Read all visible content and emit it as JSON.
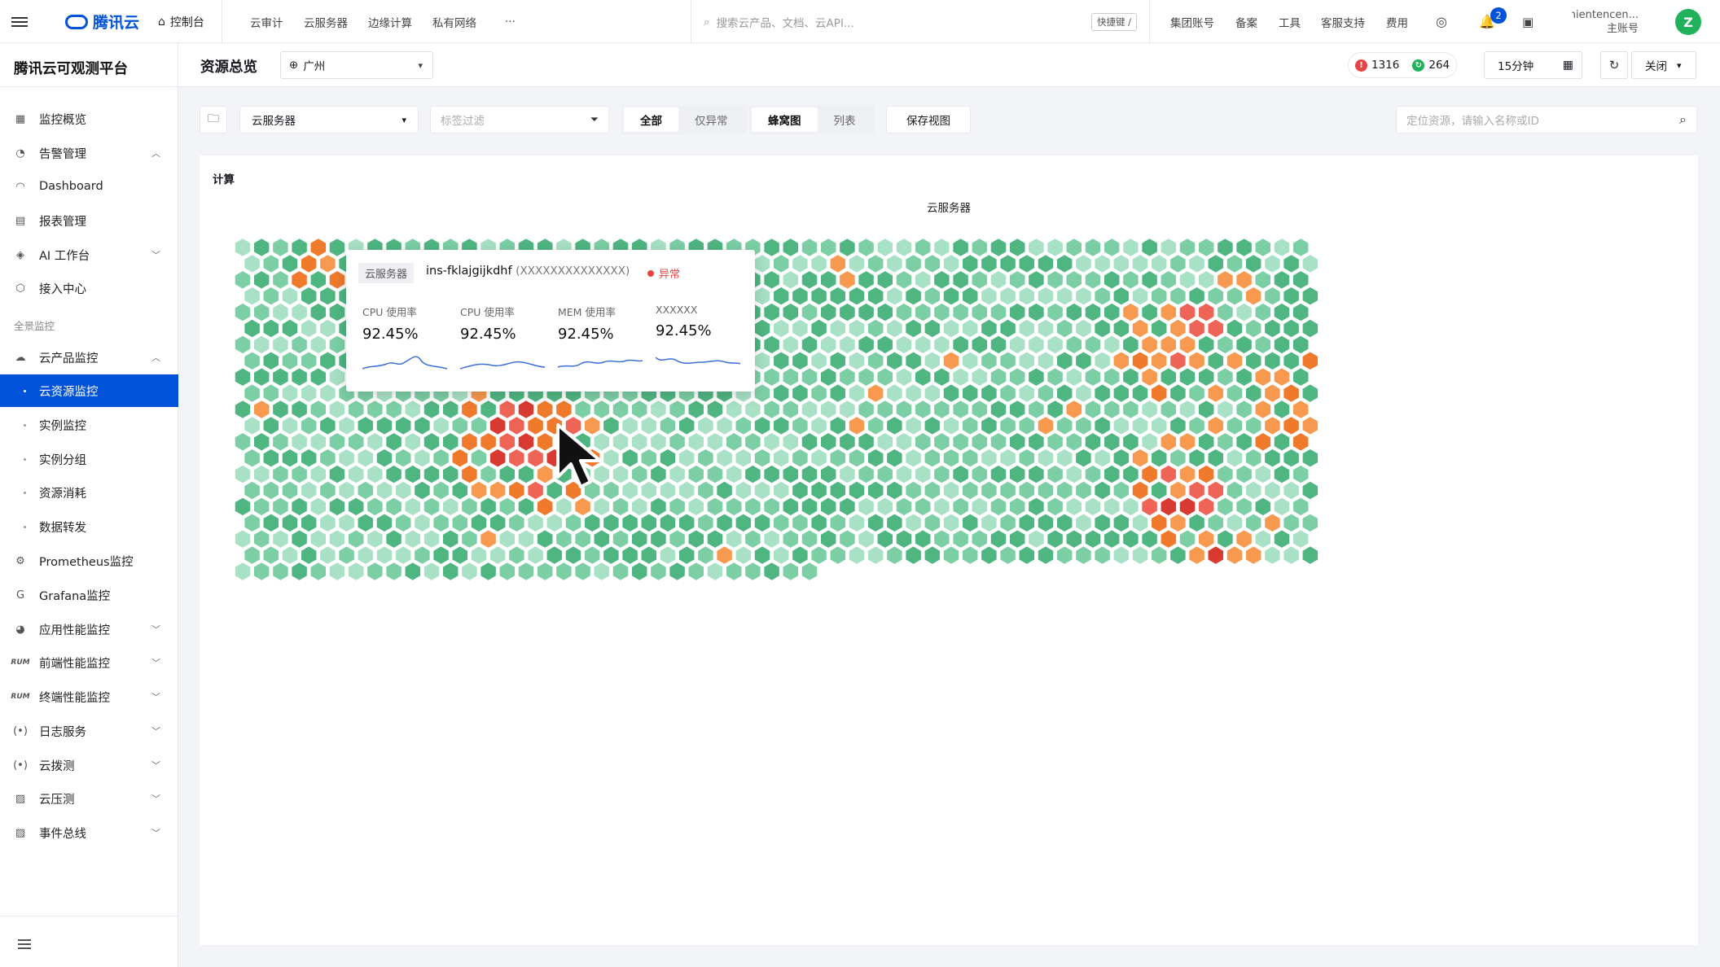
{
  "topbar": {
    "brand": "腾讯云",
    "console": "控制台",
    "nav": [
      "云审计",
      "云服务器",
      "边缘计算",
      "私有网络"
    ],
    "more": "···",
    "search_placeholder": "搜索云产品、文档、云API...",
    "shortcut": "快捷键 /",
    "links": [
      "集团账号",
      "备案",
      "工具",
      "客服支持",
      "费用"
    ],
    "notification_count": "2",
    "account_name": "milachientencen...",
    "account_role": "主账号",
    "avatar_letter": "Z"
  },
  "sidebar": {
    "title": "腾讯云可观测平台",
    "items": [
      {
        "label": "监控概览",
        "icon": "grid-icon"
      },
      {
        "label": "告警管理",
        "icon": "alarm-icon",
        "chevron": "up"
      },
      {
        "label": "Dashboard",
        "icon": "gauge-icon"
      },
      {
        "label": "报表管理",
        "icon": "report-icon"
      },
      {
        "label": "AI 工作台",
        "icon": "ai-icon",
        "chevron": "down"
      },
      {
        "label": "接入中心",
        "icon": "hub-icon"
      }
    ],
    "group_label": "全景监控",
    "items2": [
      {
        "label": "云产品监控",
        "icon": "cloud-icon",
        "chevron": "up"
      },
      {
        "label": "云资源监控",
        "sub": true,
        "active": true
      },
      {
        "label": "实例监控",
        "sub": true
      },
      {
        "label": "实例分组",
        "sub": true
      },
      {
        "label": "资源消耗",
        "sub": true
      },
      {
        "label": "数据转发",
        "sub": true
      },
      {
        "label": "Prometheus监控",
        "icon": "prometheus-icon"
      },
      {
        "label": "Grafana监控",
        "icon": "grafana-icon"
      },
      {
        "label": "应用性能监控",
        "icon": "apm-icon",
        "chevron": "down"
      },
      {
        "label": "前端性能监控",
        "icon": "rum-icon",
        "chevron": "down"
      },
      {
        "label": "终端性能监控",
        "icon": "rum-icon",
        "chevron": "down"
      },
      {
        "label": "日志服务",
        "icon": "log-icon",
        "chevron": "down"
      },
      {
        "label": "云拨测",
        "icon": "probe-icon",
        "chevron": "down"
      },
      {
        "label": "云压测",
        "icon": "pressure-icon",
        "chevron": "down"
      },
      {
        "label": "事件总线",
        "icon": "event-icon",
        "chevron": "down"
      }
    ]
  },
  "header": {
    "page_title": "资源总览",
    "region": "广州",
    "alarm_count": "1316",
    "ok_count": "264",
    "time_range": "15分钟",
    "close_label": "关闭"
  },
  "toolbar": {
    "product": "云服务器",
    "tag_placeholder": "标签过滤",
    "filter_options": [
      "全部",
      "仅异常"
    ],
    "view_options": [
      "蜂窝图",
      "列表"
    ],
    "save_view": "保存视图",
    "locate_placeholder": "定位资源，请输入名称或ID"
  },
  "panel": {
    "section": "计算",
    "chart_title": "云服务器"
  },
  "tooltip": {
    "tag": "云服务器",
    "name": "ins-fklajgijkdhf",
    "id": "(XXXXXXXXXXXXXX)",
    "status": "异常",
    "metrics": [
      {
        "name": "CPU 使用率",
        "value": "92.45%"
      },
      {
        "name": "CPU 使用率",
        "value": "92.45%"
      },
      {
        "name": "MEM 使用率",
        "value": "92.45%"
      },
      {
        "name": "XXXXXX",
        "value": "92.45%"
      }
    ]
  },
  "colors": {
    "primary": "#0052d9",
    "hex_palette": [
      "#a8e1c5",
      "#7ccfa5",
      "#4fb682",
      "#f79a4f",
      "#ef7a2b",
      "#ee6456",
      "#d83a31"
    ]
  }
}
